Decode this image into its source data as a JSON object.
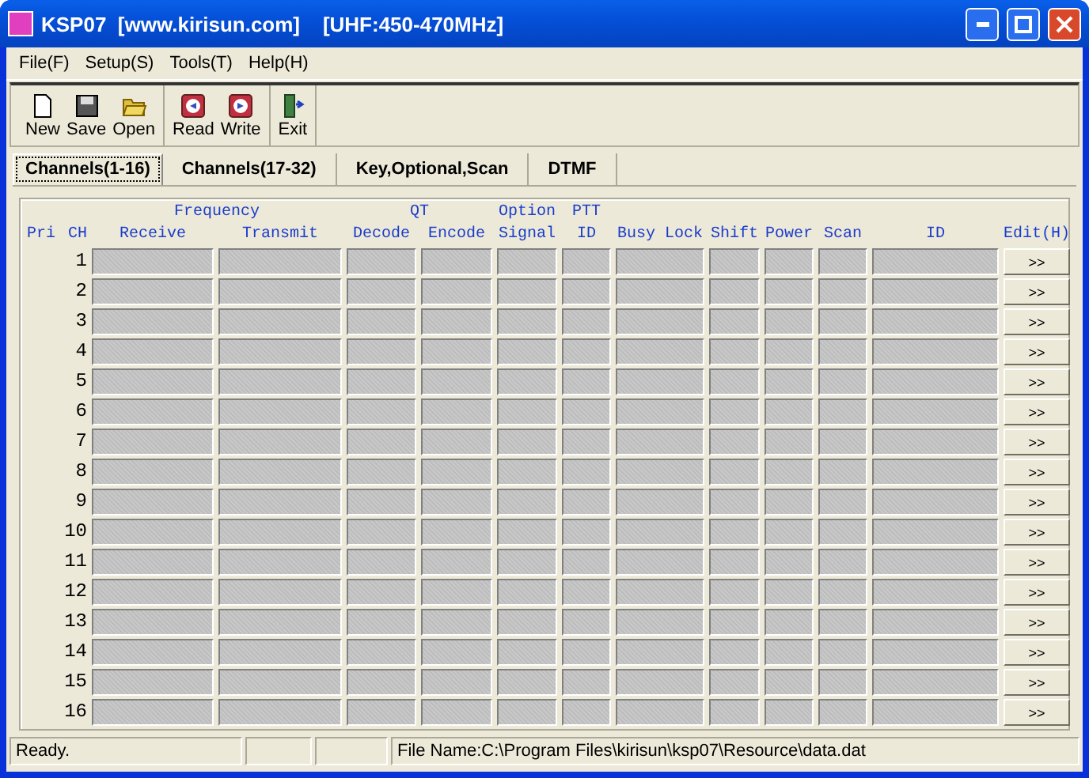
{
  "window": {
    "title": "KSP07  [www.kirisun.com]    [UHF:450-470MHz]"
  },
  "menu": [
    "File(F)",
    "Setup(S)",
    "Tools(T)",
    "Help(H)"
  ],
  "toolbar": [
    [
      {
        "label": "New",
        "kind": "new"
      },
      {
        "label": "Save",
        "kind": "save"
      },
      {
        "label": "Open",
        "kind": "open"
      }
    ],
    [
      {
        "label": "Read",
        "kind": "read"
      },
      {
        "label": "Write",
        "kind": "write"
      }
    ],
    [
      {
        "label": "Exit",
        "kind": "exit"
      }
    ]
  ],
  "tabs": [
    {
      "label": "Channels(1-16)",
      "selected": true
    },
    {
      "label": "Channels(17-32)",
      "selected": false
    },
    {
      "label": "Key,Optional,Scan",
      "selected": false
    },
    {
      "label": "DTMF",
      "selected": false
    }
  ],
  "table": {
    "lead": [
      "Pri",
      "CH"
    ],
    "groups": [
      {
        "top": "Frequency",
        "columns": [
          "Receive",
          "Transmit"
        ]
      },
      {
        "top": "QT",
        "columns": [
          "Decode",
          "Encode"
        ]
      },
      {
        "top": "Option",
        "columns": [
          "Signal"
        ]
      },
      {
        "top": "PTT",
        "columns": [
          "ID"
        ]
      },
      {
        "columns": [
          "Busy Lock"
        ]
      },
      {
        "columns": [
          "Shift"
        ]
      },
      {
        "columns": [
          "Power"
        ]
      },
      {
        "columns": [
          "Scan"
        ]
      },
      {
        "columns": [
          "ID"
        ]
      },
      {
        "columns": [
          "Edit(H)"
        ]
      }
    ],
    "rows": [
      {
        "ch": "1",
        "edit": ">>",
        "disabled": true
      },
      {
        "ch": "2",
        "edit": ">>",
        "disabled": true
      },
      {
        "ch": "3",
        "edit": ">>",
        "disabled": true
      },
      {
        "ch": "4",
        "edit": ">>",
        "disabled": true
      },
      {
        "ch": "5",
        "edit": ">>",
        "disabled": true
      },
      {
        "ch": "6",
        "edit": ">>",
        "disabled": true
      },
      {
        "ch": "7",
        "edit": ">>",
        "disabled": true
      },
      {
        "ch": "8",
        "edit": ">>",
        "disabled": true
      },
      {
        "ch": "9",
        "edit": ">>",
        "disabled": true
      },
      {
        "ch": "10",
        "edit": ">>",
        "disabled": true
      },
      {
        "ch": "11",
        "edit": ">>",
        "disabled": true
      },
      {
        "ch": "12",
        "edit": ">>",
        "disabled": true
      },
      {
        "ch": "13",
        "edit": ">>",
        "disabled": true
      },
      {
        "ch": "14",
        "edit": ">>",
        "disabled": true
      },
      {
        "ch": "15",
        "edit": ">>",
        "disabled": true
      },
      {
        "ch": "16",
        "edit": ">>",
        "disabled": true
      }
    ]
  },
  "status_bar": {
    "message": "Ready.",
    "file": "File Name:C:\\Program Files\\kirisun\\ksp07\\Resource\\data.dat"
  }
}
